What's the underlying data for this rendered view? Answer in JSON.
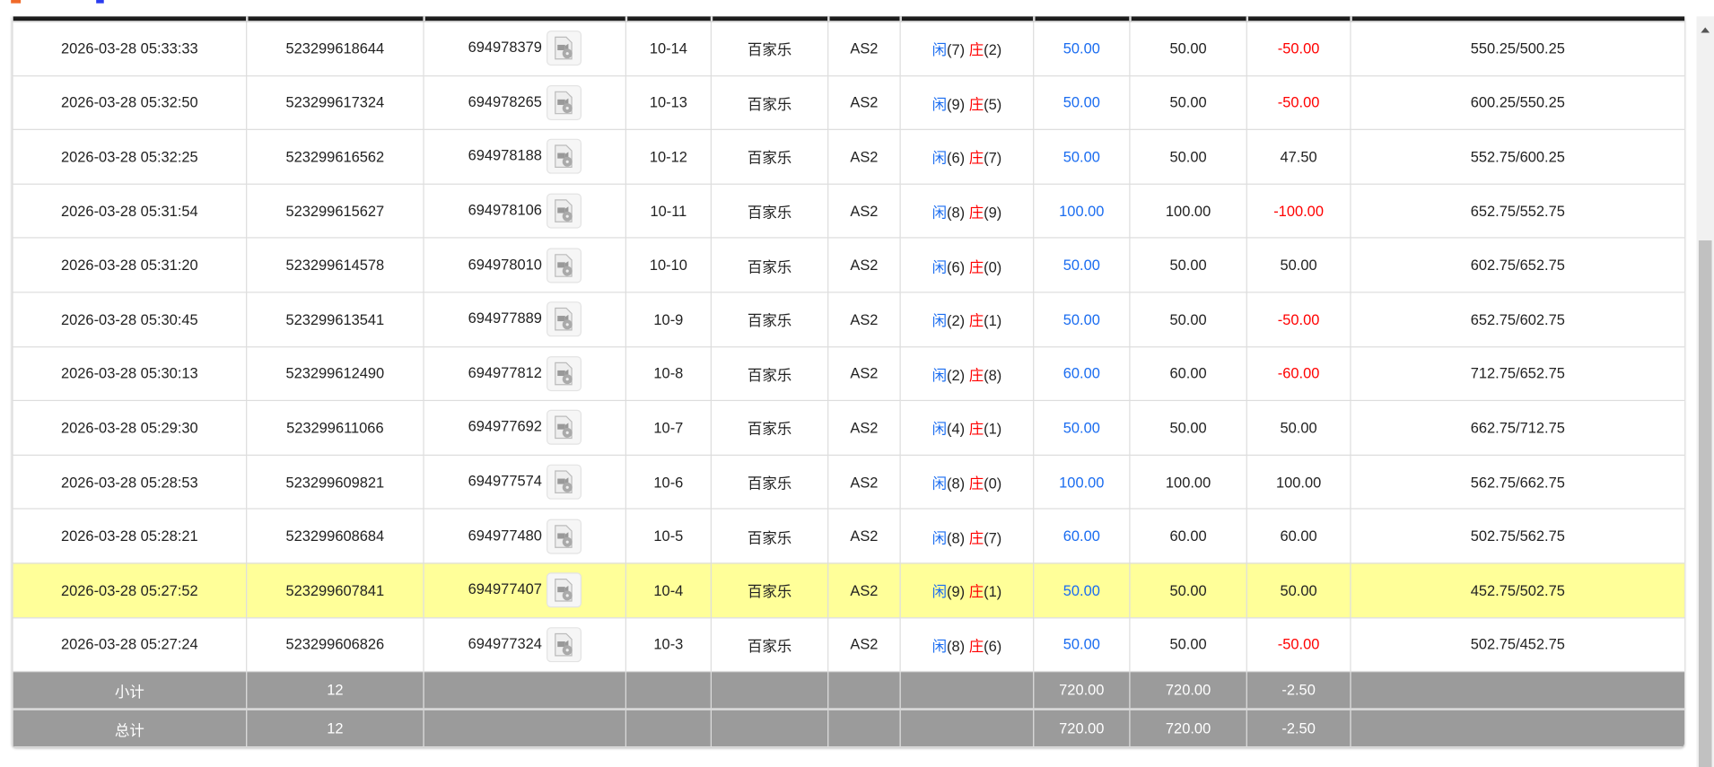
{
  "colors": {
    "player": "#1a6cf0",
    "banker": "#ff0000",
    "negative": "#ff0000",
    "bet": "#1a6cf0",
    "highlight_row": "#ffff99",
    "summary_bg": "#9b9b9b",
    "header_bar": "#1c1c1c"
  },
  "rows": [
    {
      "time": "2026-03-28 05:33:33",
      "bet_no": "523299618644",
      "round_no": "694978379",
      "shoe": "10-14",
      "game": "百家乐",
      "table": "AS2",
      "player_label": "闲",
      "player_pts": "(7)",
      "banker_label": "庄",
      "banker_pts": "(2)",
      "bet": "50.00",
      "valid": "50.00",
      "result": "-50.00",
      "balance": "550.25/500.25",
      "highlight": false
    },
    {
      "time": "2026-03-28 05:32:50",
      "bet_no": "523299617324",
      "round_no": "694978265",
      "shoe": "10-13",
      "game": "百家乐",
      "table": "AS2",
      "player_label": "闲",
      "player_pts": "(9)",
      "banker_label": "庄",
      "banker_pts": "(5)",
      "bet": "50.00",
      "valid": "50.00",
      "result": "-50.00",
      "balance": "600.25/550.25",
      "highlight": false
    },
    {
      "time": "2026-03-28 05:32:25",
      "bet_no": "523299616562",
      "round_no": "694978188",
      "shoe": "10-12",
      "game": "百家乐",
      "table": "AS2",
      "player_label": "闲",
      "player_pts": "(6)",
      "banker_label": "庄",
      "banker_pts": "(7)",
      "bet": "50.00",
      "valid": "50.00",
      "result": "47.50",
      "balance": "552.75/600.25",
      "highlight": false
    },
    {
      "time": "2026-03-28 05:31:54",
      "bet_no": "523299615627",
      "round_no": "694978106",
      "shoe": "10-11",
      "game": "百家乐",
      "table": "AS2",
      "player_label": "闲",
      "player_pts": "(8)",
      "banker_label": "庄",
      "banker_pts": "(9)",
      "bet": "100.00",
      "valid": "100.00",
      "result": "-100.00",
      "balance": "652.75/552.75",
      "highlight": false
    },
    {
      "time": "2026-03-28 05:31:20",
      "bet_no": "523299614578",
      "round_no": "694978010",
      "shoe": "10-10",
      "game": "百家乐",
      "table": "AS2",
      "player_label": "闲",
      "player_pts": "(6)",
      "banker_label": "庄",
      "banker_pts": "(0)",
      "bet": "50.00",
      "valid": "50.00",
      "result": "50.00",
      "balance": "602.75/652.75",
      "highlight": false
    },
    {
      "time": "2026-03-28 05:30:45",
      "bet_no": "523299613541",
      "round_no": "694977889",
      "shoe": "10-9",
      "game": "百家乐",
      "table": "AS2",
      "player_label": "闲",
      "player_pts": "(2)",
      "banker_label": "庄",
      "banker_pts": "(1)",
      "bet": "50.00",
      "valid": "50.00",
      "result": "-50.00",
      "balance": "652.75/602.75",
      "highlight": false
    },
    {
      "time": "2026-03-28 05:30:13",
      "bet_no": "523299612490",
      "round_no": "694977812",
      "shoe": "10-8",
      "game": "百家乐",
      "table": "AS2",
      "player_label": "闲",
      "player_pts": "(2)",
      "banker_label": "庄",
      "banker_pts": "(8)",
      "bet": "60.00",
      "valid": "60.00",
      "result": "-60.00",
      "balance": "712.75/652.75",
      "highlight": false
    },
    {
      "time": "2026-03-28 05:29:30",
      "bet_no": "523299611066",
      "round_no": "694977692",
      "shoe": "10-7",
      "game": "百家乐",
      "table": "AS2",
      "player_label": "闲",
      "player_pts": "(4)",
      "banker_label": "庄",
      "banker_pts": "(1)",
      "bet": "50.00",
      "valid": "50.00",
      "result": "50.00",
      "balance": "662.75/712.75",
      "highlight": false
    },
    {
      "time": "2026-03-28 05:28:53",
      "bet_no": "523299609821",
      "round_no": "694977574",
      "shoe": "10-6",
      "game": "百家乐",
      "table": "AS2",
      "player_label": "闲",
      "player_pts": "(8)",
      "banker_label": "庄",
      "banker_pts": "(0)",
      "bet": "100.00",
      "valid": "100.00",
      "result": "100.00",
      "balance": "562.75/662.75",
      "highlight": false
    },
    {
      "time": "2026-03-28 05:28:21",
      "bet_no": "523299608684",
      "round_no": "694977480",
      "shoe": "10-5",
      "game": "百家乐",
      "table": "AS2",
      "player_label": "闲",
      "player_pts": "(8)",
      "banker_label": "庄",
      "banker_pts": "(7)",
      "bet": "60.00",
      "valid": "60.00",
      "result": "60.00",
      "balance": "502.75/562.75",
      "highlight": false
    },
    {
      "time": "2026-03-28 05:27:52",
      "bet_no": "523299607841",
      "round_no": "694977407",
      "shoe": "10-4",
      "game": "百家乐",
      "table": "AS2",
      "player_label": "闲",
      "player_pts": "(9)",
      "banker_label": "庄",
      "banker_pts": "(1)",
      "bet": "50.00",
      "valid": "50.00",
      "result": "50.00",
      "balance": "452.75/502.75",
      "highlight": true
    },
    {
      "time": "2026-03-28 05:27:24",
      "bet_no": "523299606826",
      "round_no": "694977324",
      "shoe": "10-3",
      "game": "百家乐",
      "table": "AS2",
      "player_label": "闲",
      "player_pts": "(8)",
      "banker_label": "庄",
      "banker_pts": "(6)",
      "bet": "50.00",
      "valid": "50.00",
      "result": "-50.00",
      "balance": "502.75/452.75",
      "highlight": false
    }
  ],
  "summary": [
    {
      "label": "小计",
      "count": "12",
      "bet": "720.00",
      "valid": "720.00",
      "result": "-2.50"
    },
    {
      "label": "总计",
      "count": "12",
      "bet": "720.00",
      "valid": "720.00",
      "result": "-2.50"
    }
  ],
  "icons": {
    "replay": "video-replay-icon"
  }
}
